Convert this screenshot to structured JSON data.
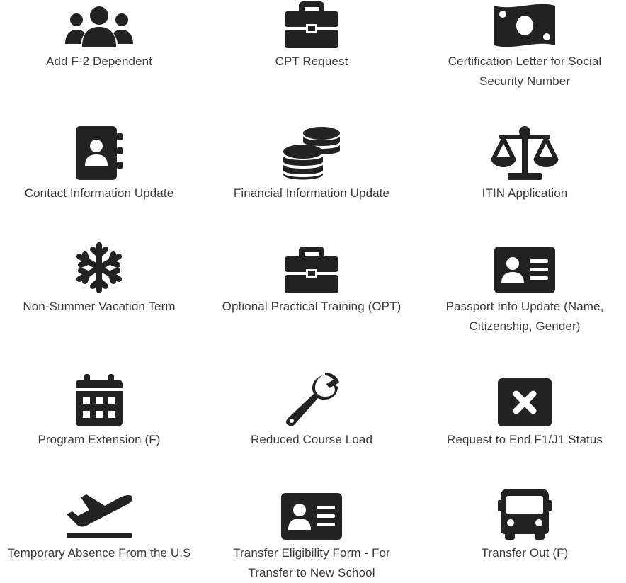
{
  "tiles": [
    {
      "label": "Add F-2 Dependent",
      "icon": "users-icon"
    },
    {
      "label": "CPT Request",
      "icon": "briefcase-icon"
    },
    {
      "label": "Certification Letter for Social Security Number",
      "icon": "money-bill-icon"
    },
    {
      "label": "Contact Information Update",
      "icon": "address-book-icon"
    },
    {
      "label": "Financial Information Update",
      "icon": "coins-icon"
    },
    {
      "label": "ITIN Application",
      "icon": "balance-scale-icon"
    },
    {
      "label": "Non-Summer Vacation Term",
      "icon": "snowflake-icon"
    },
    {
      "label": "Optional Practical Training (OPT)",
      "icon": "briefcase-icon"
    },
    {
      "label": "Passport Info Update (Name, Citizenship, Gender)",
      "icon": "id-card-icon"
    },
    {
      "label": "Program Extension (F)",
      "icon": "calendar-icon"
    },
    {
      "label": "Reduced Course Load",
      "icon": "wrench-icon"
    },
    {
      "label": "Request to End F1/J1 Status",
      "icon": "close-box-icon"
    },
    {
      "label": "Temporary Absence From the U.S",
      "icon": "plane-departure-icon"
    },
    {
      "label": "Transfer Eligibility Form - For Transfer to New School",
      "icon": "id-card-icon"
    },
    {
      "label": "Transfer Out (F)",
      "icon": "bus-icon"
    }
  ],
  "colors": {
    "icon": "#222222",
    "text": "#3a3a3a",
    "background": "#ffffff"
  }
}
